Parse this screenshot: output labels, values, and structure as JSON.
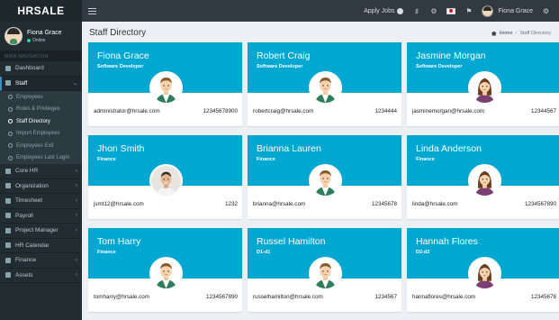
{
  "app": {
    "logo": "HRSALE"
  },
  "topbar": {
    "apply_jobs": "Apply Jobs",
    "user_name": "Fiona Grace",
    "icons": [
      "menu-icon",
      "bell-icon",
      "gear-icon",
      "japan-flag-icon",
      "flag-icon",
      "settings-icon"
    ]
  },
  "sidebar": {
    "user": {
      "name": "Fiona Grace",
      "status": "Online"
    },
    "nav_header": "MAIN NAVIGATION",
    "items": [
      {
        "label": "Dashboard"
      },
      {
        "label": "Staff",
        "expanded": true
      },
      {
        "label": "Core HR"
      },
      {
        "label": "Organization"
      },
      {
        "label": "Timesheet"
      },
      {
        "label": "Payroll"
      },
      {
        "label": "Project Manager"
      },
      {
        "label": "HR Calendar"
      },
      {
        "label": "Finance"
      },
      {
        "label": "Assets"
      }
    ],
    "staff_submenu": [
      {
        "label": "Employees"
      },
      {
        "label": "Roles & Privileges"
      },
      {
        "label": "Staff Directory",
        "current": true
      },
      {
        "label": "Import Employees"
      },
      {
        "label": "Employees Exit"
      },
      {
        "label": "Employees Last Login"
      }
    ]
  },
  "page": {
    "title": "Staff Directory",
    "breadcrumb": {
      "home": "Home",
      "current": "Staff Directory"
    }
  },
  "colors": {
    "card_header": "#00a7d0",
    "sidebar": "#222d32",
    "accent": "#3c8dbc"
  },
  "staff": [
    {
      "name": "Fiona Grace",
      "role": "Software Developer",
      "email": "administrator@hrsale.com",
      "phone": "12345678900",
      "avatar": "male-cartoon-avatar"
    },
    {
      "name": "Robert Craig",
      "role": "Software Developer",
      "email": "robertcraig@hrsale.com",
      "phone": "1234444",
      "avatar": "male-cartoon-avatar"
    },
    {
      "name": "Jasmine Morgan",
      "role": "Software Developer",
      "email": "jasminemorgan@hrsale.com",
      "phone": "12344567",
      "avatar": "female-cartoon-avatar"
    },
    {
      "name": "Jhon Smith",
      "role": "Finance",
      "email": "jsmt12@hrsale.com",
      "phone": "1232",
      "avatar": "photo-avatar"
    },
    {
      "name": "Brianna Lauren",
      "role": "Finance",
      "email": "brianna@hrsale.com",
      "phone": "12345678",
      "avatar": "male-cartoon-avatar"
    },
    {
      "name": "Linda Anderson",
      "role": "Finance",
      "email": "linda@hrsale.com",
      "phone": "1234567890",
      "avatar": "female-cartoon-avatar"
    },
    {
      "name": "Tom Harry",
      "role": "Finance",
      "email": "tomharry@hrsale.com",
      "phone": "1234567890",
      "avatar": "male-cartoon-avatar"
    },
    {
      "name": "Russel Hamilton",
      "role": "D1-d1",
      "email": "russelhamilton@hrsale.com",
      "phone": "1234567",
      "avatar": "male-cartoon-avatar"
    },
    {
      "name": "Hannah Flores",
      "role": "D2-d2",
      "email": "hannaflores@hrsale.com",
      "phone": "12345678",
      "avatar": "female-cartoon-avatar"
    }
  ]
}
